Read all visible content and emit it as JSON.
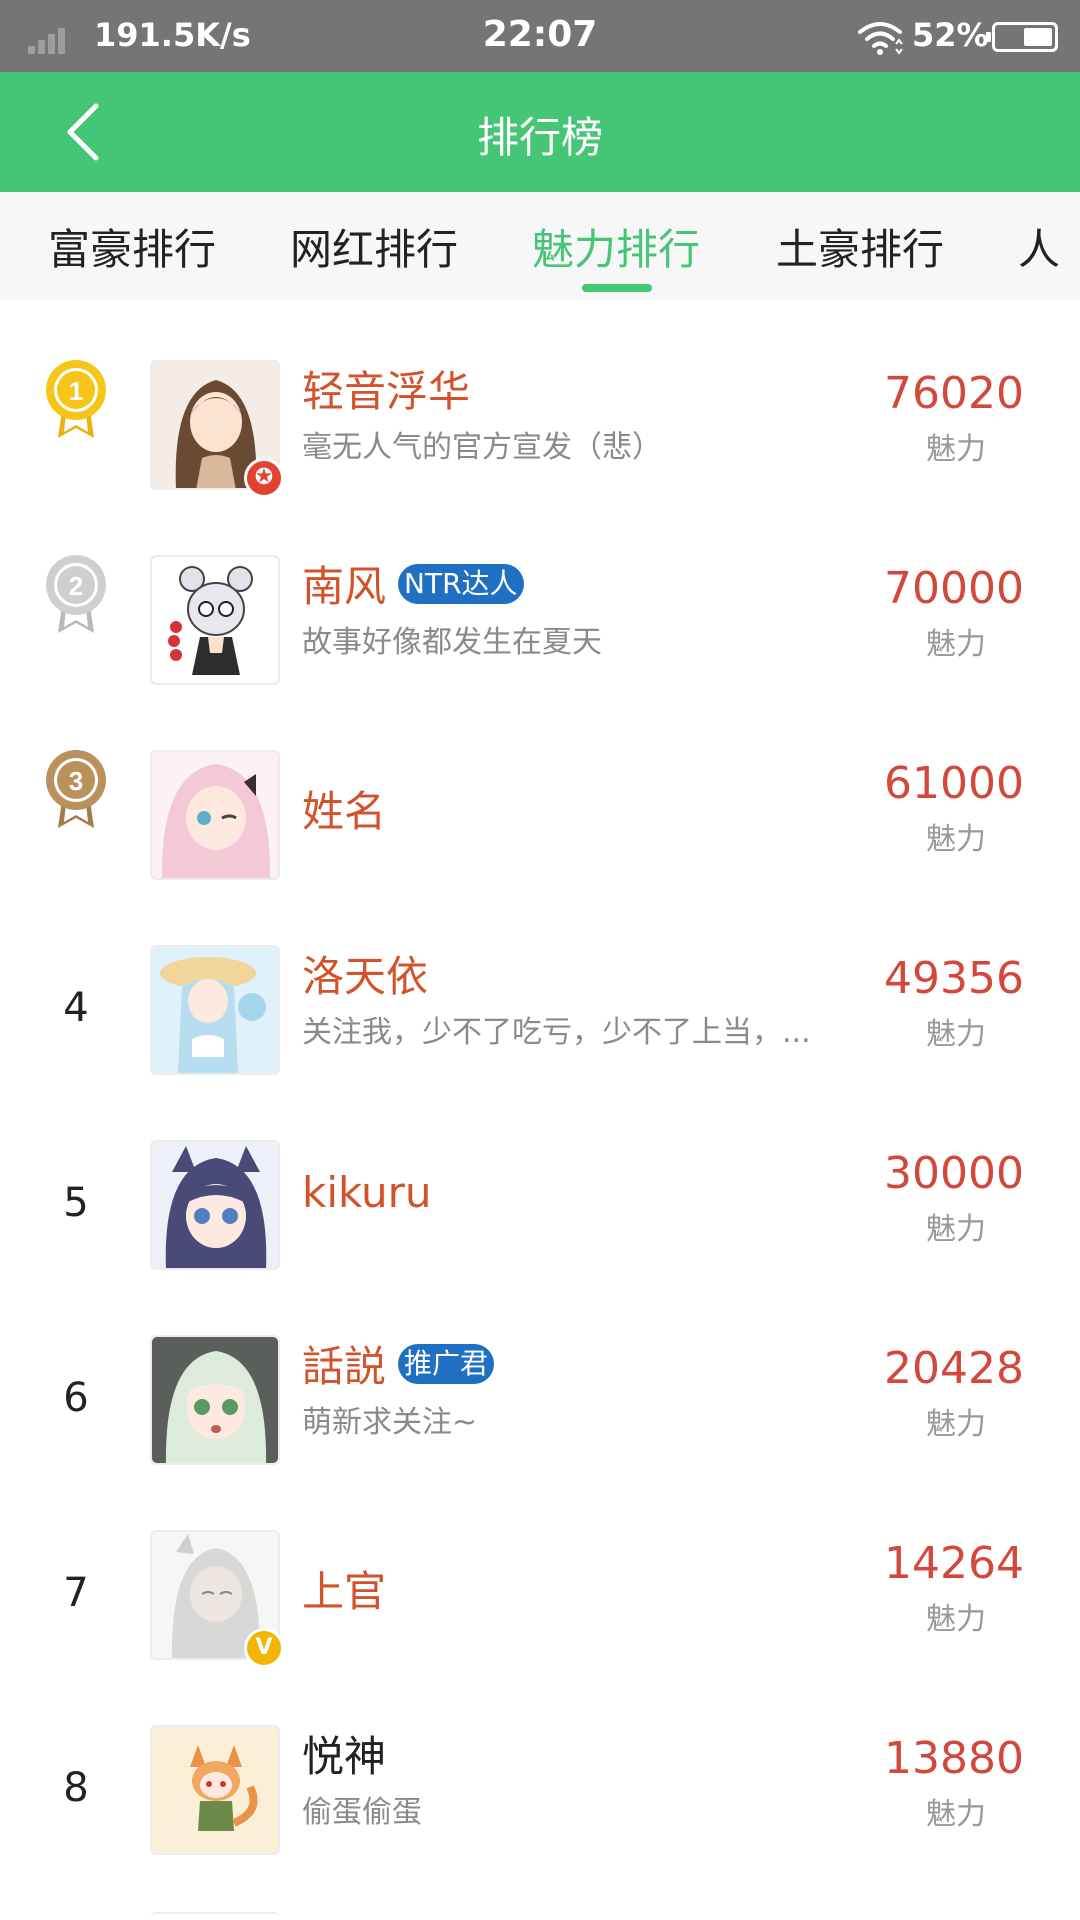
{
  "status_bar": {
    "network_speed": "191.5K/s",
    "time": "22:07",
    "battery_percent": "52%",
    "battery_level": 0.52,
    "signal_icon": "signal-icon",
    "wifi_icon": "wifi-icon"
  },
  "app_bar": {
    "title": "排行榜",
    "back_icon": "back-arrow-icon",
    "color": "#45c676"
  },
  "tabs": [
    {
      "label": "富豪排行",
      "active": false
    },
    {
      "label": "网红排行",
      "active": false
    },
    {
      "label": "魅力排行",
      "active": true
    },
    {
      "label": "土豪排行",
      "active": false
    },
    {
      "label": "人",
      "active": false
    }
  ],
  "ranking": [
    {
      "rank": "1",
      "medal": "gold",
      "name": "轻音浮华",
      "tag": "",
      "bio": "毫无人气的官方宣发（悲）",
      "score": "76020",
      "unit": "魅力",
      "badge": "star-badge",
      "name_color": "#d2532b"
    },
    {
      "rank": "2",
      "medal": "silver",
      "name": "南风",
      "tag": "NTR达人",
      "bio": "故事好像都发生在夏天",
      "score": "70000",
      "unit": "魅力",
      "badge": "",
      "name_color": "#d2532b"
    },
    {
      "rank": "3",
      "medal": "bronze",
      "name": "姓名",
      "tag": "",
      "bio": "",
      "score": "61000",
      "unit": "魅力",
      "badge": "",
      "name_color": "#d2532b"
    },
    {
      "rank": "4",
      "medal": "",
      "name": "洛天依",
      "tag": "",
      "bio": "关注我，少不了吃亏，少不了上当，...",
      "score": "49356",
      "unit": "魅力",
      "badge": "",
      "name_color": "#d2532b"
    },
    {
      "rank": "5",
      "medal": "",
      "name": "kikuru",
      "tag": "",
      "bio": "",
      "score": "30000",
      "unit": "魅力",
      "badge": "",
      "name_color": "#d2532b"
    },
    {
      "rank": "6",
      "medal": "",
      "name": "話説",
      "tag": "推广君",
      "bio": "萌新求关注~",
      "score": "20428",
      "unit": "魅力",
      "badge": "",
      "name_color": "#d2532b"
    },
    {
      "rank": "7",
      "medal": "",
      "name": "上官",
      "tag": "",
      "bio": "",
      "score": "14264",
      "unit": "魅力",
      "badge": "v-badge",
      "name_color": "#d2532b"
    },
    {
      "rank": "8",
      "medal": "",
      "name": "悦神",
      "tag": "",
      "bio": "偷蛋偷蛋",
      "score": "13880",
      "unit": "魅力",
      "badge": "",
      "name_color": "#222222"
    }
  ],
  "colors": {
    "accent": "#45c676",
    "score": "#d2483c",
    "name": "#d2532b",
    "gold": "#f5c518",
    "silver": "#c8c8c8",
    "bronze": "#b8925a"
  }
}
